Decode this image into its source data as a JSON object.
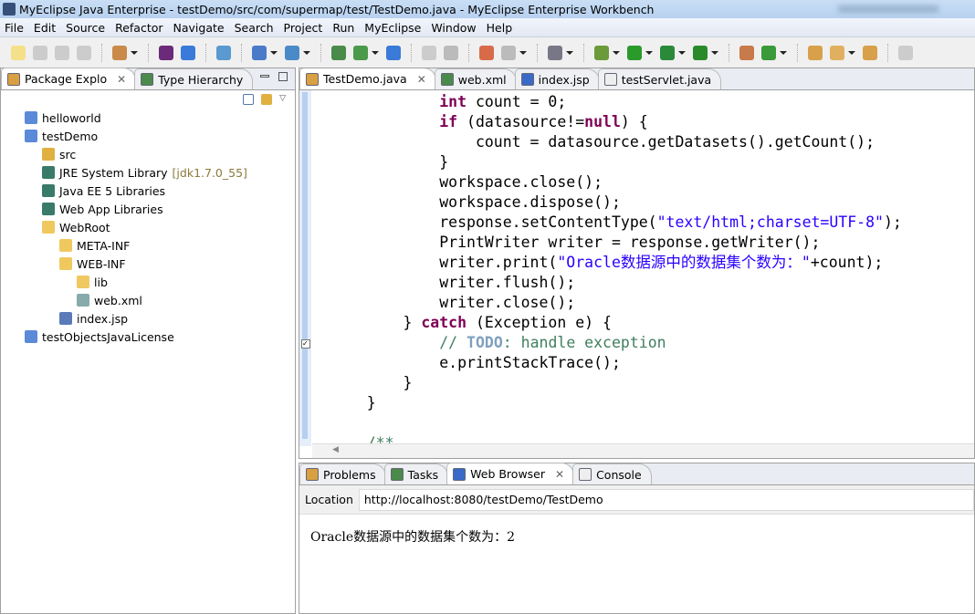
{
  "window": {
    "title": "MyEclipse Java Enterprise - testDemo/src/com/supermap/test/TestDemo.java - MyEclipse Enterprise Workbench"
  },
  "menu": [
    "File",
    "Edit",
    "Source",
    "Refactor",
    "Navigate",
    "Search",
    "Project",
    "Run",
    "MyEclipse",
    "Window",
    "Help"
  ],
  "left_tabs": [
    {
      "label": "Package Explo",
      "active": true
    },
    {
      "label": "Type Hierarchy",
      "active": false
    }
  ],
  "tree": [
    {
      "label": "helloworld",
      "level": 0,
      "icon": "project-icon"
    },
    {
      "label": "testDemo",
      "level": 0,
      "icon": "project-icon"
    },
    {
      "label": "src",
      "level": 1,
      "icon": "source-folder-icon"
    },
    {
      "label": "JRE System Library",
      "extra": "[jdk1.7.0_55]",
      "level": 1,
      "icon": "library-icon"
    },
    {
      "label": "Java EE 5 Libraries",
      "level": 1,
      "icon": "library-icon"
    },
    {
      "label": "Web App Libraries",
      "level": 1,
      "icon": "library-icon"
    },
    {
      "label": "WebRoot",
      "level": 1,
      "icon": "folder-icon"
    },
    {
      "label": "META-INF",
      "level": 2,
      "icon": "folder-icon"
    },
    {
      "label": "WEB-INF",
      "level": 2,
      "icon": "folder-icon"
    },
    {
      "label": "lib",
      "level": 3,
      "icon": "folder-icon"
    },
    {
      "label": "web.xml",
      "level": 3,
      "icon": "xml-file-icon"
    },
    {
      "label": "index.jsp",
      "level": 2,
      "icon": "jsp-file-icon"
    },
    {
      "label": "testObjectsJavaLicense",
      "level": 0,
      "icon": "project-icon"
    }
  ],
  "editor_tabs": [
    {
      "label": "TestDemo.java",
      "active": true
    },
    {
      "label": "web.xml"
    },
    {
      "label": "index.jsp"
    },
    {
      "label": "testServlet.java"
    }
  ],
  "code": [
    [
      [
        "            ",
        ""
      ],
      [
        "int",
        "kw"
      ],
      [
        " count = 0;",
        ""
      ]
    ],
    [
      [
        "            ",
        ""
      ],
      [
        "if",
        "kw"
      ],
      [
        " (datasource!=",
        ""
      ],
      [
        "null",
        "kw"
      ],
      [
        ") {",
        ""
      ]
    ],
    [
      [
        "                count = datasource.getDatasets().getCount();",
        ""
      ]
    ],
    [
      [
        "            }",
        ""
      ]
    ],
    [
      [
        "            workspace.close();",
        ""
      ]
    ],
    [
      [
        "            workspace.dispose();",
        ""
      ]
    ],
    [
      [
        "            response.setContentType(",
        ""
      ],
      [
        "\"text/html;charset=UTF-8\"",
        "str"
      ],
      [
        ");",
        ""
      ]
    ],
    [
      [
        "            PrintWriter writer = response.getWriter();",
        ""
      ]
    ],
    [
      [
        "            writer.print(",
        ""
      ],
      [
        "\"Oracle数据源中的数据集个数为：\"",
        "str"
      ],
      [
        "+count);",
        ""
      ]
    ],
    [
      [
        "            writer.flush();",
        ""
      ]
    ],
    [
      [
        "            writer.close();",
        ""
      ]
    ],
    [
      [
        "        } ",
        ""
      ],
      [
        "catch",
        "kw"
      ],
      [
        " (Exception e) {",
        ""
      ]
    ],
    [
      [
        "            ",
        ""
      ],
      [
        "// ",
        "cm"
      ],
      [
        "TODO",
        "todo"
      ],
      [
        ": handle exception",
        "cm"
      ]
    ],
    [
      [
        "            e.printStackTrace();",
        ""
      ]
    ],
    [
      [
        "        }",
        ""
      ]
    ],
    [
      [
        "    }",
        ""
      ]
    ],
    [
      [
        "",
        ""
      ]
    ],
    [
      [
        "    ",
        ""
      ],
      [
        "/**",
        "cm"
      ]
    ]
  ],
  "bottom_tabs": [
    {
      "label": "Problems"
    },
    {
      "label": "Tasks"
    },
    {
      "label": "Web Browser",
      "active": true
    },
    {
      "label": "Console"
    }
  ],
  "browser": {
    "location_label": "Location",
    "url": "http://localhost:8080/testDemo/TestDemo",
    "content": "Oracle数据源中的数据集个数为：2"
  }
}
